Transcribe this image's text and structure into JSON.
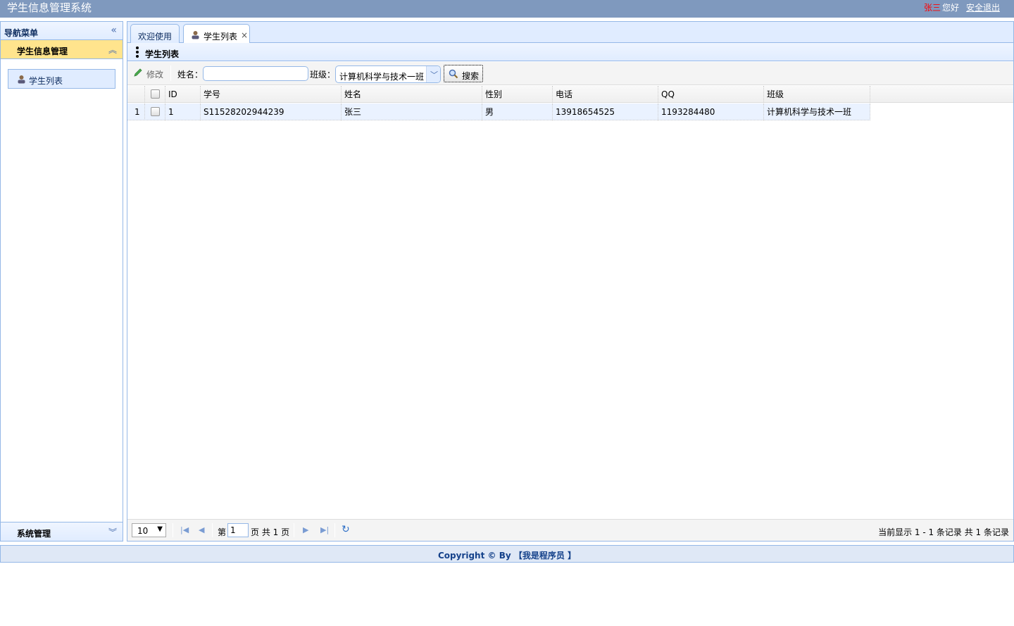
{
  "header": {
    "title": "学生信息管理系统",
    "user_name": "张三",
    "greeting": "您好",
    "logout": "安全退出",
    "colors": {
      "bar": "#7f99be",
      "user_name": "#ff0000"
    }
  },
  "nav": {
    "title": "导航菜单",
    "sections": [
      {
        "label": "学生信息管理",
        "expanded": true,
        "items": [
          {
            "label": "学生列表",
            "icon": "user-icon"
          }
        ]
      },
      {
        "label": "系统管理",
        "expanded": false
      }
    ]
  },
  "tabs": [
    {
      "label": "欢迎使用",
      "closable": false,
      "active": false
    },
    {
      "label": "学生列表",
      "closable": true,
      "active": true,
      "close": "×"
    }
  ],
  "panel": {
    "title": "学生列表",
    "toolbar": {
      "edit_label": "修改",
      "name_label": "姓名：",
      "name_value": "",
      "class_label": "班级：",
      "class_value": "计算机科学与技术一班",
      "search_label": "搜索"
    }
  },
  "grid": {
    "columns": [
      "ID",
      "学号",
      "姓名",
      "性别",
      "电话",
      "QQ",
      "班级"
    ],
    "rows": [
      {
        "row_number": "1",
        "id": "1",
        "student_no": "S11528202944239",
        "name": "张三",
        "gender": "男",
        "phone": "13918654525",
        "qq": "1193284480",
        "class": "计算机科学与技术一班"
      }
    ]
  },
  "pager": {
    "page_size": "10",
    "page_prefix": "第",
    "current_page": "1",
    "page_suffix": "页 共 1 页",
    "record_info": "当前显示 1 - 1 条记录 共 1 条记录"
  },
  "footer": {
    "copyright": "Copyright © By 【我是程序员 】"
  }
}
